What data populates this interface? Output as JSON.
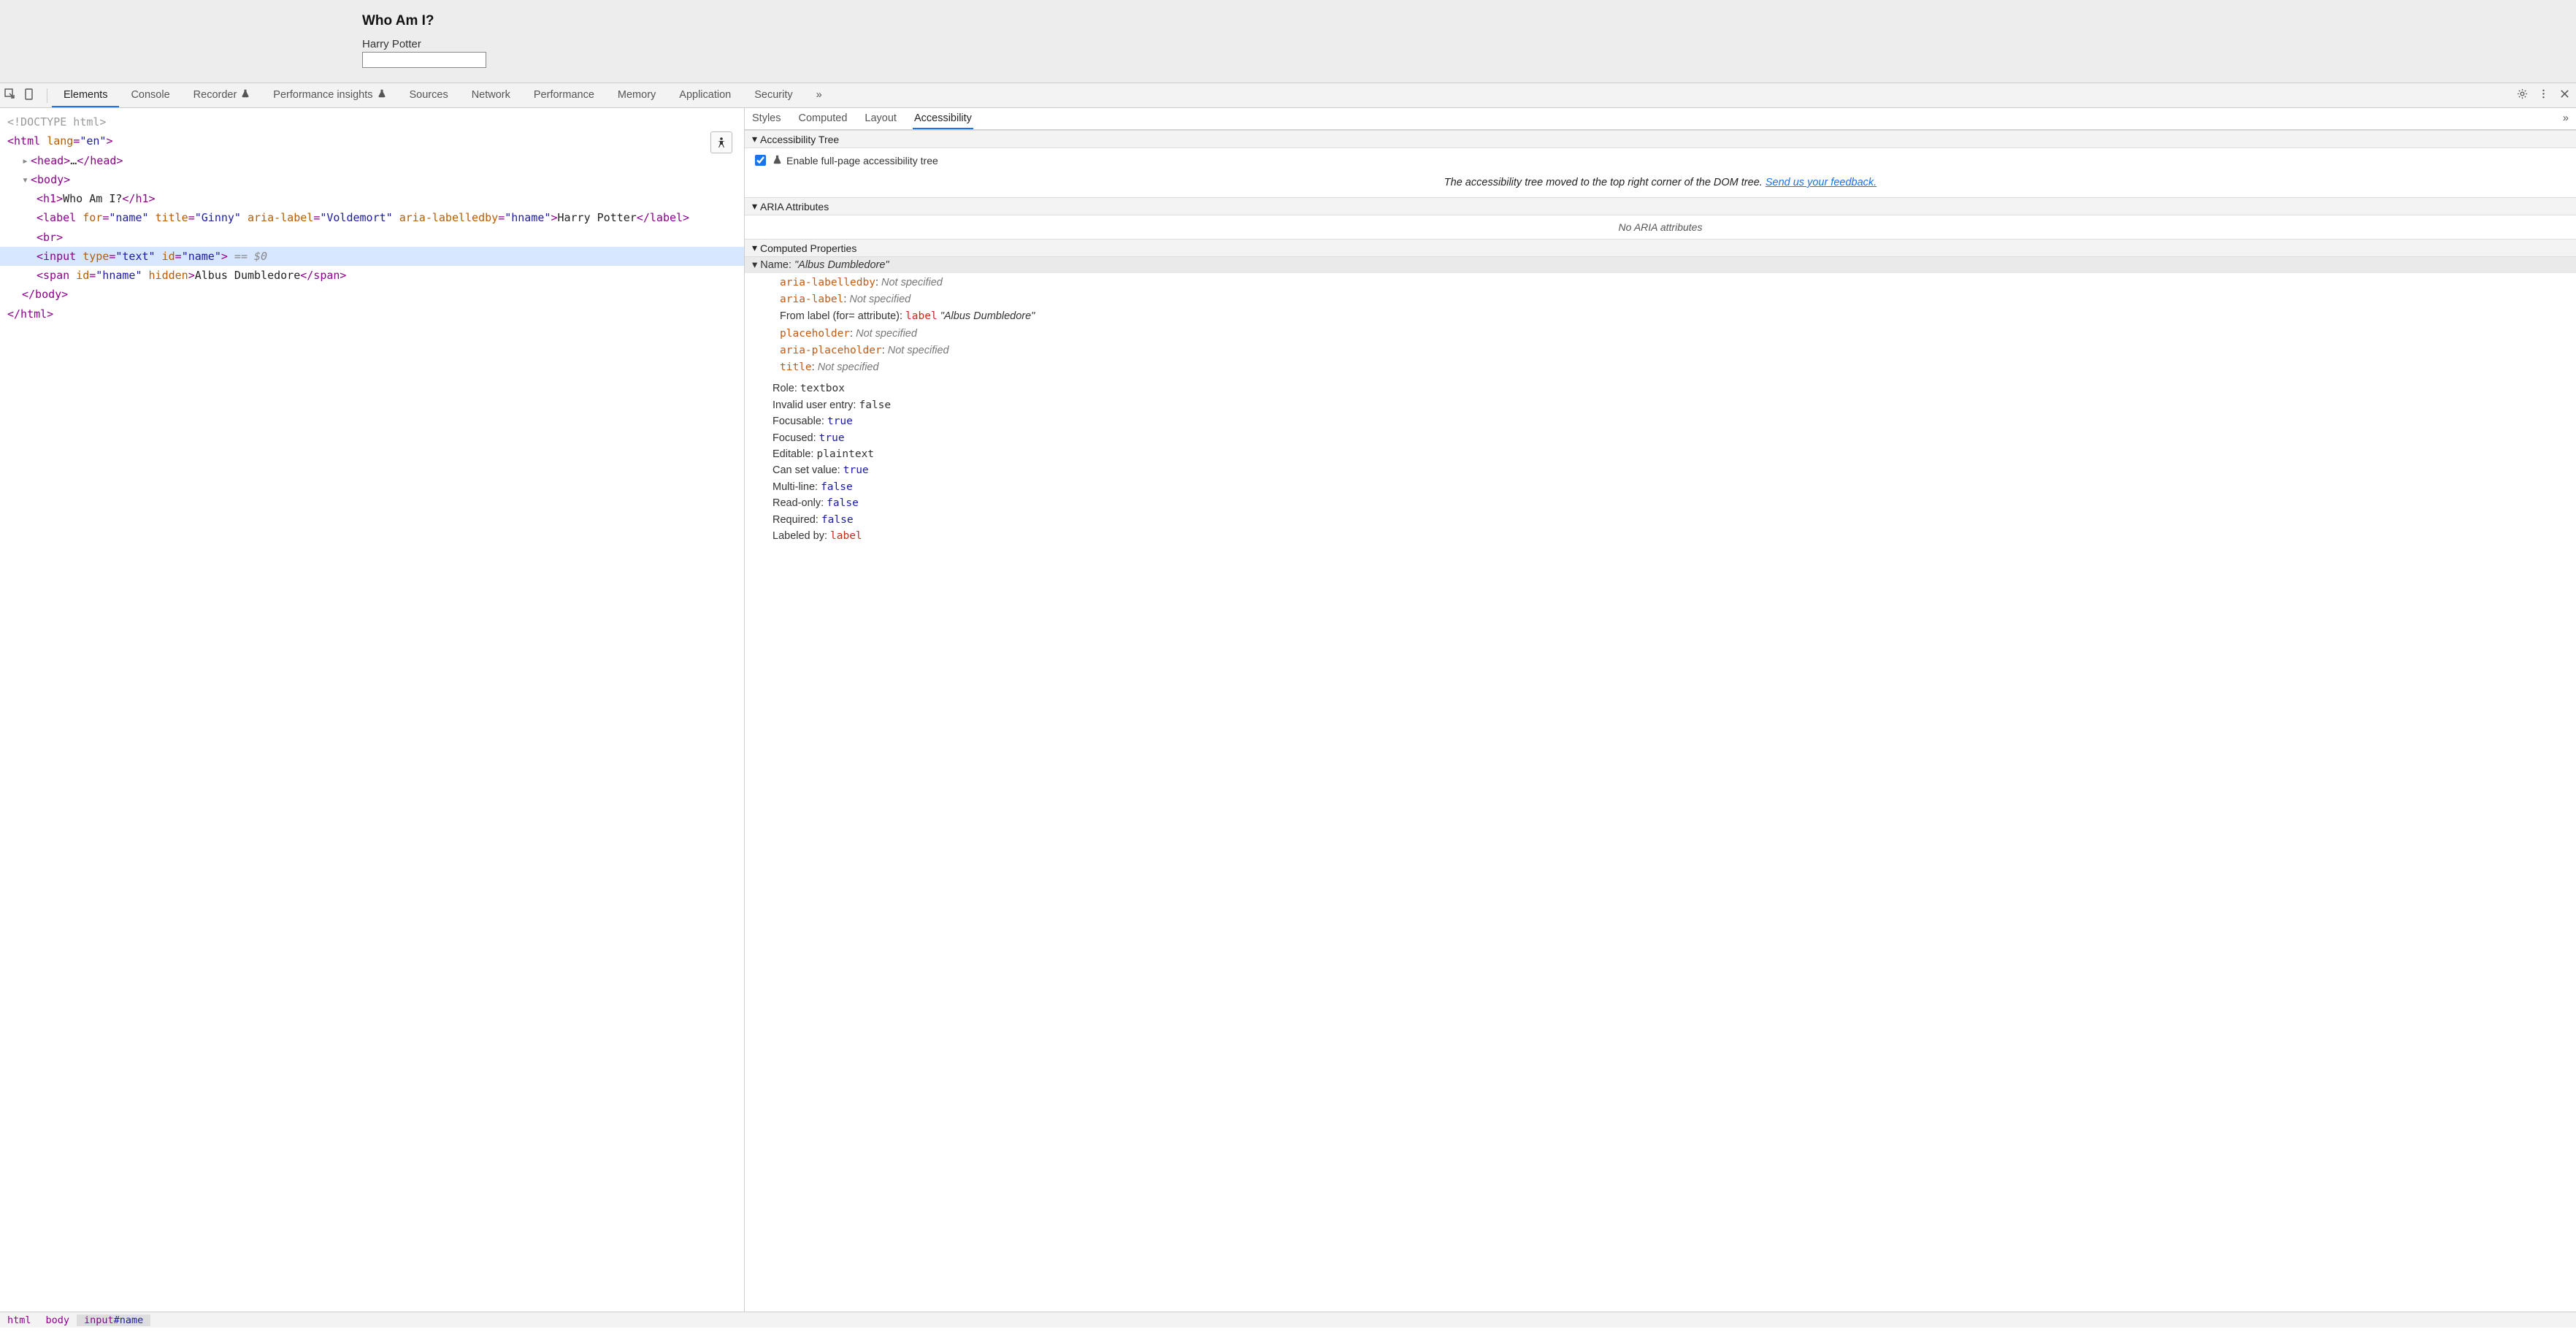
{
  "page": {
    "heading": "Who Am I?",
    "labelText": "Harry Potter",
    "inputValue": ""
  },
  "toolbar": {
    "tabs": [
      "Elements",
      "Console",
      "Recorder",
      "Performance insights",
      "Sources",
      "Network",
      "Performance",
      "Memory",
      "Application",
      "Security"
    ],
    "overflow": "»",
    "activeTab": "Elements"
  },
  "dom": {
    "doctype": "<!DOCTYPE html>",
    "htmlOpen_pre": "<html ",
    "htmlOpen_attr": "lang",
    "htmlOpen_val": "\"en\"",
    "htmlOpen_post": ">",
    "headCollapsed_pre": "<head>",
    "headCollapsed_mid": "…",
    "headCollapsed_post": "</head>",
    "bodyOpen": "<body>",
    "h1_pre": "<h1>",
    "h1_text": "Who Am I?",
    "h1_post": "</h1>",
    "label_pre": "<label ",
    "label_attrs": "for=\"name\" title=\"Ginny\" aria-label=\"Voldemort\" aria-labelledby=\"hname\"",
    "label_mid": ">",
    "label_text": "Harry Potter",
    "label_post": "</label>",
    "br": "<br>",
    "input_pre": "<input ",
    "input_attrs": "type=\"text\" id=\"name\"",
    "input_post": ">",
    "input_sel": " == $0",
    "span_pre": "<span ",
    "span_attrs": "id=\"hname\" hidden",
    "span_mid": ">",
    "span_text": "Albus Dumbledore",
    "span_post": "</span>",
    "bodyClose": "</body>",
    "htmlClose": "</html>"
  },
  "sidebar": {
    "tabs": [
      "Styles",
      "Computed",
      "Layout",
      "Accessibility"
    ],
    "activeTab": "Accessibility",
    "overflow": "»",
    "treeHeader": "Accessibility Tree",
    "enableLabel": "Enable full-page accessibility tree",
    "hintPrefix": "The accessibility tree moved to the top right corner of the DOM tree. ",
    "hintLink": "Send us your feedback.",
    "ariaHeader": "ARIA Attributes",
    "ariaNone": "No ARIA attributes",
    "computedHeader": "Computed Properties",
    "nameLabel": "Name: ",
    "nameValue": "\"Albus Dumbledore\"",
    "nameSources": [
      {
        "key": "aria-labelledby",
        "keyClass": "k-orange",
        "value": "Not specified",
        "valClass": "v-gray",
        "mono": true
      },
      {
        "key": "aria-label",
        "keyClass": "k-orange",
        "value": "Not specified",
        "valClass": "v-gray",
        "mono": true
      },
      {
        "plain": "From label (for= attribute): ",
        "key": "label",
        "keyClass": "k-red",
        "value": " \"Albus Dumbledore\"",
        "valClass": "v-italic",
        "mono": true
      },
      {
        "key": "placeholder",
        "keyClass": "k-orange",
        "value": "Not specified",
        "valClass": "v-gray",
        "mono": true
      },
      {
        "key": "aria-placeholder",
        "keyClass": "k-orange",
        "value": "Not specified",
        "valClass": "v-gray",
        "mono": true
      },
      {
        "key": "title",
        "keyClass": "k-orange",
        "value": "Not specified",
        "valClass": "v-gray",
        "mono": true
      }
    ],
    "props": [
      {
        "k": "Role",
        "v": "textbox",
        "mono": true
      },
      {
        "k": "Invalid user entry",
        "v": "false",
        "mono": true
      },
      {
        "k": "Focusable",
        "v": "true",
        "mono": true,
        "blue": true
      },
      {
        "k": "Focused",
        "v": "true",
        "mono": true,
        "blue": true
      },
      {
        "k": "Editable",
        "v": "plaintext",
        "mono": true
      },
      {
        "k": "Can set value",
        "v": "true",
        "mono": true,
        "blue": true
      },
      {
        "k": "Multi-line",
        "v": "false",
        "mono": true,
        "blue": true
      },
      {
        "k": "Read-only",
        "v": "false",
        "mono": true,
        "blue": true
      },
      {
        "k": "Required",
        "v": "false",
        "mono": true,
        "blue": true
      },
      {
        "k": "Labeled by",
        "v": "label",
        "mono": true,
        "red": true
      }
    ]
  },
  "breadcrumb": {
    "items": [
      "html",
      "body",
      "input#name"
    ],
    "activeIndex": 2
  }
}
